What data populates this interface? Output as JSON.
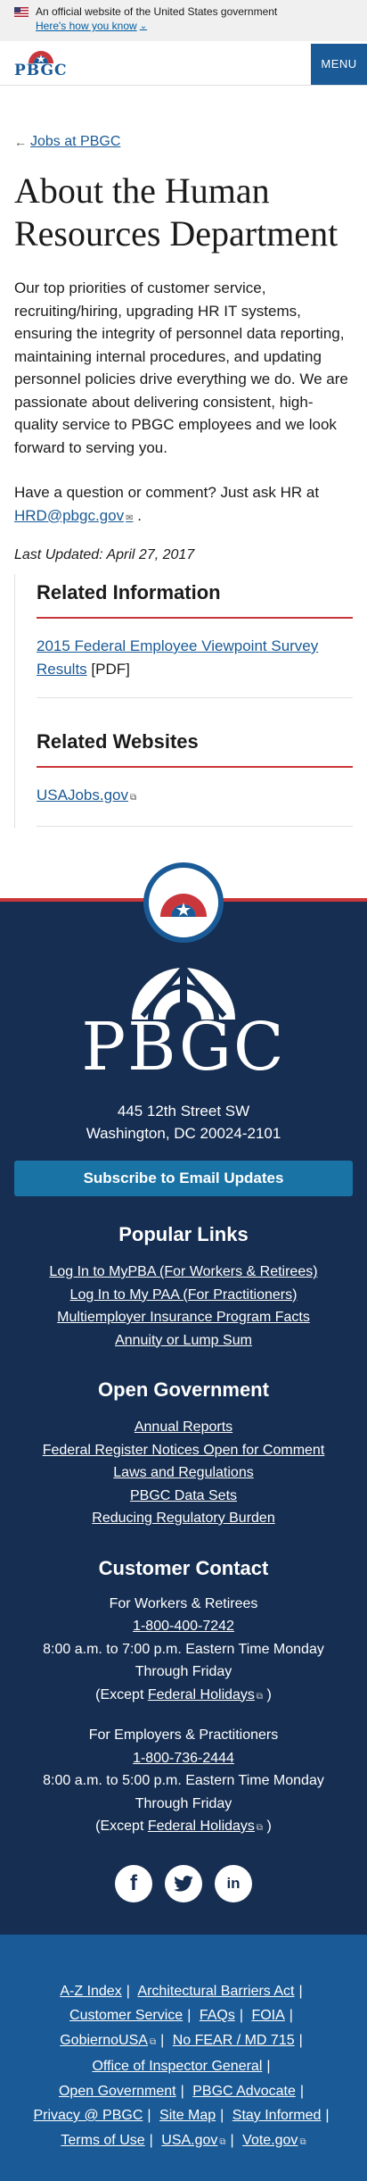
{
  "gov_banner": {
    "official_text": "An official website of the United States government",
    "how_you_know": "Here's how you know"
  },
  "header": {
    "logo_text": "PBGC",
    "menu_label": "MENU"
  },
  "main": {
    "back_link": "Jobs at PBGC",
    "title": "About the Human Resources Department",
    "intro": "Our top priorities of customer service, recruiting/hiring, upgrading HR IT systems, ensuring the integrity of personnel data reporting, maintaining internal procedures, and updating personnel policies drive everything we do. We are passionate about delivering consistent, high-quality service to PBGC employees and we look forward to serving you.",
    "contact_prefix": "Have a question or comment? Just ask HR at",
    "contact_email": "HRD@pbgc.gov",
    "contact_suffix": ".",
    "last_updated": "Last Updated: April 27, 2017"
  },
  "related_info": {
    "heading": "Related Information",
    "link": "2015 Federal Employee Viewpoint Survey Results",
    "link_suffix": "[PDF]"
  },
  "related_websites": {
    "heading": "Related Websites",
    "link": "USAJobs.gov"
  },
  "footer": {
    "logo_text": "PBGC",
    "address_line1": "445 12th Street SW",
    "address_line2": "Washington, DC 20024-2101",
    "subscribe": "Subscribe to Email Updates",
    "popular_heading": "Popular Links",
    "popular_links": [
      "Log In to MyPBA (For Workers & Retirees)",
      "Log In to My PAA (For Practitioners)",
      "Multiemployer Insurance Program Facts",
      "Annuity or Lump Sum"
    ],
    "open_gov_heading": "Open Government",
    "open_gov_links": [
      "Annual Reports",
      "Federal Register Notices Open for Comment",
      "Laws and Regulations",
      "PBGC Data Sets",
      "Reducing Regulatory Burden"
    ],
    "contact_heading": "Customer Contact",
    "workers": {
      "label": "For Workers & Retirees",
      "phone": "1-800-400-7242",
      "hours": "8:00 a.m. to 7:00 p.m. Eastern Time Monday Through Friday",
      "except_prefix": "(Except",
      "holidays": "Federal Holidays",
      "except_suffix": ")"
    },
    "practitioners": {
      "label": "For Employers & Practitioners",
      "phone": "1-800-736-2444",
      "hours": "8:00 a.m. to 5:00 p.m. Eastern Time Monday Through Friday",
      "except_prefix": "(Except",
      "holidays": "Federal Holidays",
      "except_suffix": ")"
    },
    "social": {
      "facebook": "f",
      "linkedin": "in"
    }
  },
  "bottom_links": {
    "a_z": "A-Z Index",
    "barriers": "Architectural Barriers Act",
    "customer_service": "Customer Service",
    "faqs": "FAQs",
    "foia": "FOIA",
    "gobierno": "GobiernoUSA",
    "no_fear": "No FEAR / MD 715",
    "oig": "Office of Inspector General",
    "open_gov": "Open Government",
    "advocate": "PBGC Advocate",
    "privacy": "Privacy @ PBGC",
    "site_map": "Site Map",
    "stay_informed": "Stay Informed",
    "terms": "Terms of Use",
    "usa_gov": "USA.gov",
    "vote_gov": "Vote.gov",
    "separator": "|"
  },
  "colors": {
    "primary_blue": "#1a5a96",
    "footer_navy": "#162e51",
    "accent_red": "#c9363b",
    "subscribe_blue": "#1a73a5"
  }
}
